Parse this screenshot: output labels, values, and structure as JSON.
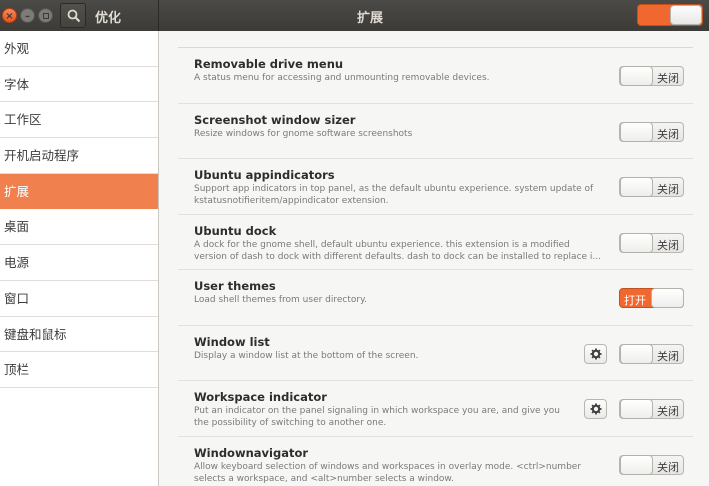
{
  "header": {
    "left_title": "优化",
    "center_title": "扩展",
    "extensions_master_switch": "on"
  },
  "sidebar": {
    "items": [
      {
        "label": "外观",
        "active": false
      },
      {
        "label": "字体",
        "active": false
      },
      {
        "label": "工作区",
        "active": false
      },
      {
        "label": "开机启动程序",
        "active": false
      },
      {
        "label": "扩展",
        "active": true
      },
      {
        "label": "桌面",
        "active": false
      },
      {
        "label": "电源",
        "active": false
      },
      {
        "label": "窗口",
        "active": false
      },
      {
        "label": "键盘和鼠标",
        "active": false
      },
      {
        "label": "顶栏",
        "active": false
      }
    ]
  },
  "extensions": [
    {
      "title": "Removable drive menu",
      "desc": [
        "A status menu for accessing and unmounting removable devices."
      ],
      "state_label": "关闭",
      "on": false,
      "has_settings": false
    },
    {
      "title": "Screenshot window sizer",
      "desc": [
        "Resize windows for gnome software screenshots"
      ],
      "state_label": "关闭",
      "on": false,
      "has_settings": false
    },
    {
      "title": "Ubuntu appindicators",
      "desc": [
        "Support app indicators in top panel, as the default ubuntu experience. system update of",
        "kstatusnotifieritem/appindicator extension."
      ],
      "state_label": "关闭",
      "on": false,
      "has_settings": false
    },
    {
      "title": "Ubuntu dock",
      "desc": [
        "A dock for the gnome shell, default ubuntu experience. this extension is a modified",
        "version of dash to dock with different defaults. dash to dock can be installed to replace i..."
      ],
      "state_label": "关闭",
      "on": false,
      "has_settings": false
    },
    {
      "title": "User themes",
      "desc": [
        "Load shell themes from user directory."
      ],
      "state_label": "打开",
      "on": true,
      "has_settings": false
    },
    {
      "title": "Window list",
      "desc": [
        "Display a window list at the bottom of the screen."
      ],
      "state_label": "关闭",
      "on": false,
      "has_settings": true
    },
    {
      "title": "Workspace indicator",
      "desc": [
        "Put an indicator on the panel signaling in which workspace you are, and give you",
        "the possibility of switching to another one."
      ],
      "state_label": "关闭",
      "on": false,
      "has_settings": true
    },
    {
      "title": "Windownavigator",
      "desc": [
        "Allow keyboard selection of windows and workspaces in overlay mode. <ctrl>number",
        "selects a workspace, and <alt>number selects a window."
      ],
      "state_label": "关闭",
      "on": false,
      "has_settings": false
    }
  ],
  "colors": {
    "accent": "#f0682f",
    "sidebar_active": "#f0804e",
    "headerbar": "#3c3b37"
  }
}
